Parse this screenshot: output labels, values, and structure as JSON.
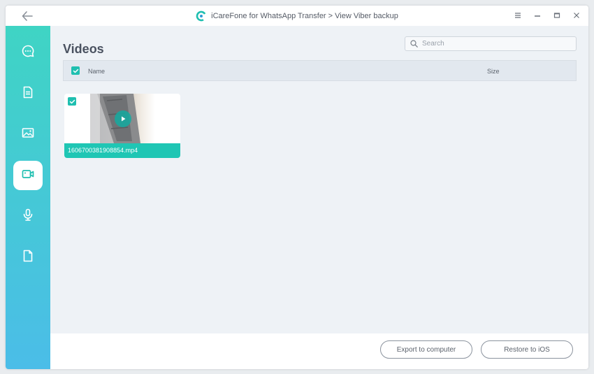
{
  "window": {
    "title": "iCareFone for WhatsApp Transfer > View Viber backup"
  },
  "sidebar": {
    "items": [
      {
        "name": "messages",
        "icon": "chat-bubble-icon",
        "active": false
      },
      {
        "name": "documents",
        "icon": "document-text-icon",
        "active": false
      },
      {
        "name": "photos",
        "icon": "image-icon",
        "active": false
      },
      {
        "name": "videos",
        "icon": "video-camera-icon",
        "active": true
      },
      {
        "name": "audio",
        "icon": "microphone-icon",
        "active": false
      },
      {
        "name": "files",
        "icon": "file-icon",
        "active": false
      }
    ]
  },
  "main": {
    "title": "Videos",
    "search": {
      "placeholder": "Search",
      "value": ""
    },
    "table": {
      "columns": [
        "Name",
        "Size"
      ]
    },
    "videos": [
      {
        "filename": "1606700381908854.mp4",
        "selected": true
      }
    ]
  },
  "footer": {
    "export_label": "Export to computer",
    "restore_label": "Restore to iOS"
  },
  "colors": {
    "accent": "#1fbfb0",
    "sidebar_top": "#3fd4c4",
    "sidebar_bottom": "#4bbde8"
  }
}
